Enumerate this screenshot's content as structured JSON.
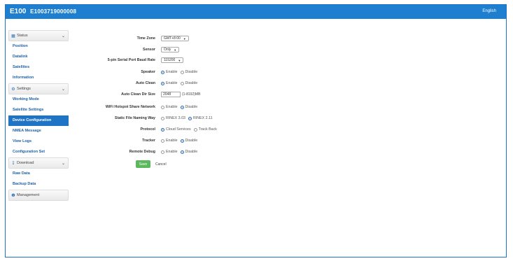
{
  "header": {
    "title": "E100",
    "serial": "E1003719000008",
    "language": "English"
  },
  "sidebar": {
    "status": {
      "label": "Status",
      "items": [
        "Position",
        "Datalink",
        "Satellites",
        "Information"
      ]
    },
    "settings": {
      "label": "Settings",
      "items": [
        "Working Mode",
        "Satellite Settings",
        "Device Configuration",
        "NMEA Message",
        "View Logs",
        "Configuration Set"
      ]
    },
    "download": {
      "label": "Download",
      "items": [
        "Raw Data",
        "Backup Data"
      ]
    },
    "management": {
      "label": "Management"
    }
  },
  "form": {
    "time_zone": {
      "label": "Time Zone",
      "value": "GMT+8:00"
    },
    "sensor": {
      "label": "Sensor",
      "value": "Only"
    },
    "baud_rate": {
      "label": "5-pin Serial Port Baud Rate",
      "value": "115200"
    },
    "speaker": {
      "label": "Speaker",
      "opt1": "Enable",
      "opt2": "Disable",
      "selected": 1
    },
    "auto_clean": {
      "label": "Auto Clean",
      "opt1": "Enable",
      "opt2": "Disable",
      "selected": 1
    },
    "auto_clean_dir_size": {
      "label": "Auto Clean Dir Size",
      "value": "2048",
      "unit": "(1-8192)MB"
    },
    "wifi_hotspot": {
      "label": "WiFi Hotspot Share Network",
      "opt1": "Enable",
      "opt2": "Disable",
      "selected": 2
    },
    "static_file_naming": {
      "label": "Static File Naming Way",
      "opt1": "RINEX 3.03",
      "opt2": "RINEX 2.11",
      "selected": 2
    },
    "protocol": {
      "label": "Protocol",
      "opt1": "Cloud Services",
      "opt2": "Track Back",
      "selected": 1
    },
    "tracker": {
      "label": "Tracker",
      "opt1": "Enable",
      "opt2": "Disable",
      "selected": 2
    },
    "remote_debug": {
      "label": "Remote Debug",
      "opt1": "Enable",
      "opt2": "Disable",
      "selected": 2
    }
  },
  "actions": {
    "save": "Save",
    "cancel": "Cancel"
  },
  "colors": {
    "header": "#1e7fd0",
    "active_item": "#1f74c6",
    "save_button": "#5bb85c",
    "link_text": "#2062a8"
  }
}
